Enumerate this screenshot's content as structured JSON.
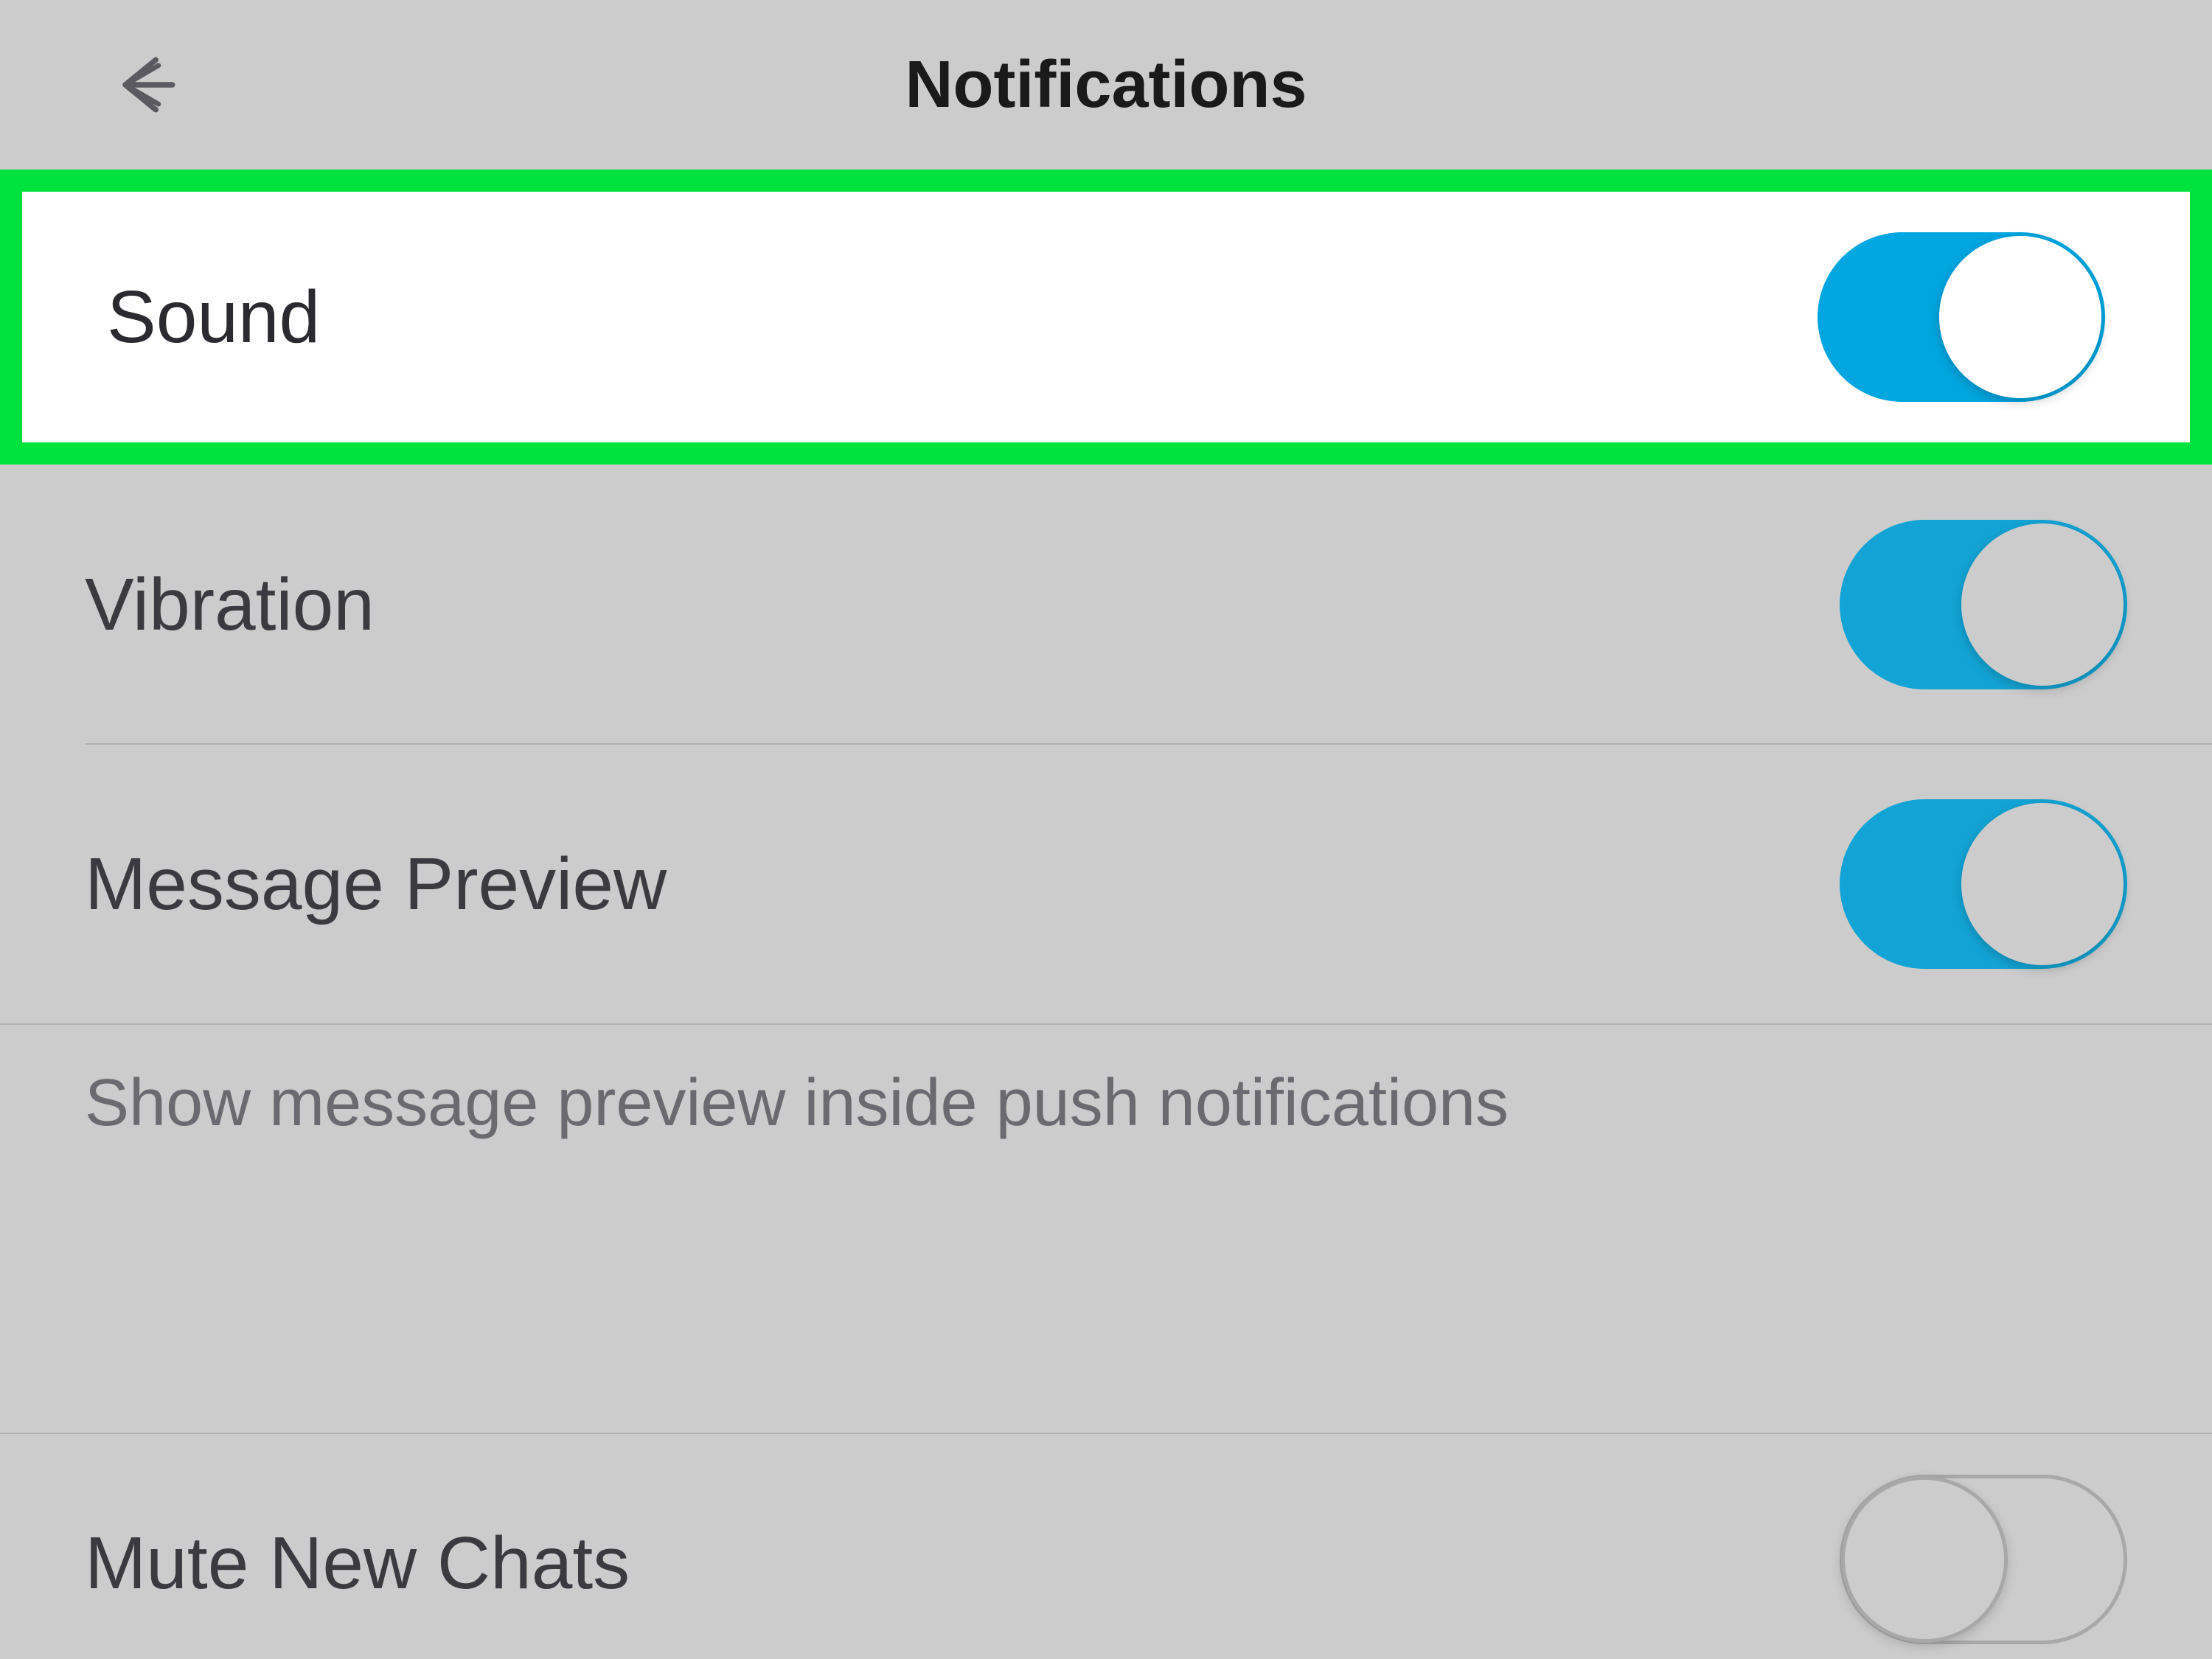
{
  "header": {
    "title": "Notifications"
  },
  "rows": {
    "sound": {
      "label": "Sound",
      "on": true,
      "highlighted": true
    },
    "vibration": {
      "label": "Vibration",
      "on": true
    },
    "message_preview": {
      "label": "Message Preview",
      "on": true
    },
    "mute_new_chats": {
      "label": "Mute New Chats",
      "on": false
    }
  },
  "description": "Show message preview inside push notifications",
  "colors": {
    "highlight": "#00e23e",
    "toggle_on": "#00a6e0",
    "background_dim": "#cccccc"
  }
}
